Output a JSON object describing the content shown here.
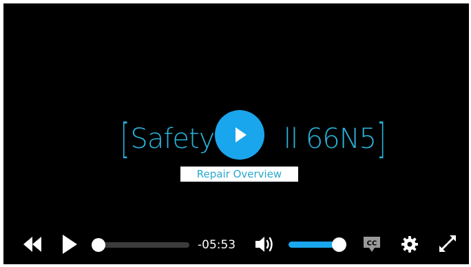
{
  "video": {
    "title": "Safety Recall 66N5",
    "title_visible_start": "Safety R",
    "title_visible_end": "ll 66N5",
    "subtitle": "Repair Overview"
  },
  "controls": {
    "time_remaining": "-05:53",
    "progress_fraction": 0.0,
    "volume_fraction": 1.0
  },
  "icons": {
    "rewind": "rewind-icon",
    "play": "play-icon",
    "big_play": "big-play-icon",
    "volume": "volume-icon",
    "captions": "cc-icon",
    "settings": "gear-icon",
    "fullscreen": "fullscreen-icon"
  },
  "colors": {
    "accent": "#1aa6ec",
    "title": "#29b2d8",
    "background": "#000000"
  }
}
